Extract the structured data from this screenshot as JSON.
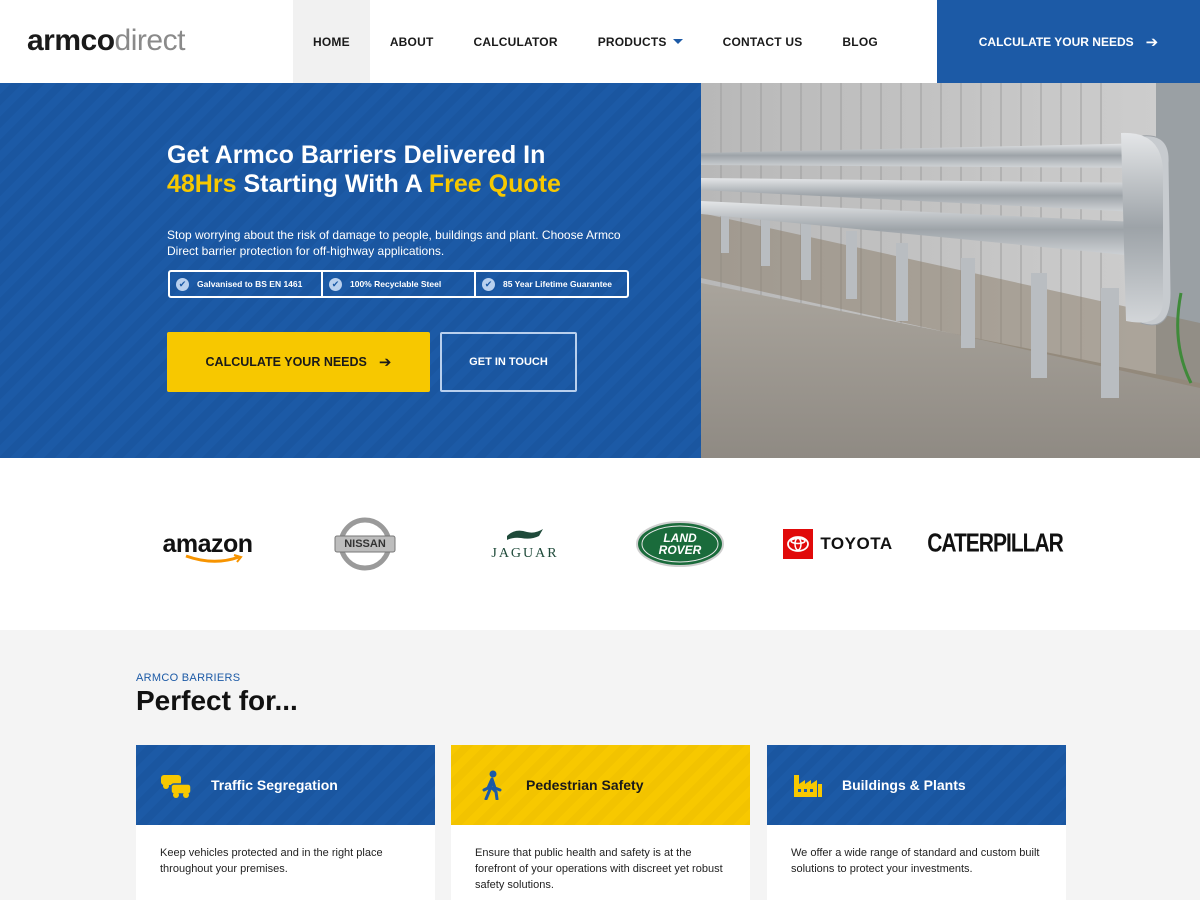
{
  "brand": {
    "logo_bold": "armco",
    "logo_light": "direct"
  },
  "nav": {
    "items": [
      {
        "label": "HOME"
      },
      {
        "label": "ABOUT"
      },
      {
        "label": "CALCULATOR"
      },
      {
        "label": "PRODUCTS"
      },
      {
        "label": "CONTACT US"
      },
      {
        "label": "BLOG"
      }
    ],
    "cta_label": "CALCULATE YOUR NEEDS"
  },
  "hero": {
    "title_part1": "Get Armco Barriers Delivered In",
    "title_highlight1": "48Hrs",
    "title_part2": "Starting With A",
    "title_highlight2": "Free Quote",
    "description": "Stop worrying about the risk of damage to people, buildings and plant. Choose Armco Direct barrier protection for off-highway applications.",
    "badges": [
      {
        "label": "Galvanised to BS EN 1461"
      },
      {
        "label": "100% Recyclable Steel"
      },
      {
        "label": "85 Year Lifetime Guarantee"
      }
    ],
    "primary_button": "CALCULATE YOUR NEEDS",
    "secondary_button": "GET IN TOUCH"
  },
  "clients": {
    "amazon": "amazon",
    "nissan": "NISSAN",
    "jaguar": "JAGUAR",
    "landrover_line1": "LAND",
    "landrover_line2": "ROVER",
    "toyota": "TOYOTA",
    "caterpillar": "CATERPILLAR"
  },
  "perfect_for": {
    "eyebrow": "ARMCO BARRIERS",
    "title": "Perfect for...",
    "cards": [
      {
        "title": "Traffic Segregation",
        "text": "Keep vehicles protected and in the right place throughout your premises."
      },
      {
        "title": "Pedestrian Safety",
        "text": "Ensure that public health and safety is at the forefront of your operations with discreet yet robust safety solutions."
      },
      {
        "title": "Buildings & Plants",
        "text": "We offer a wide range of standard and custom built solutions to protect your investments."
      }
    ]
  },
  "colors": {
    "brand_blue": "#1c5aa6",
    "brand_yellow": "#f7c800"
  }
}
